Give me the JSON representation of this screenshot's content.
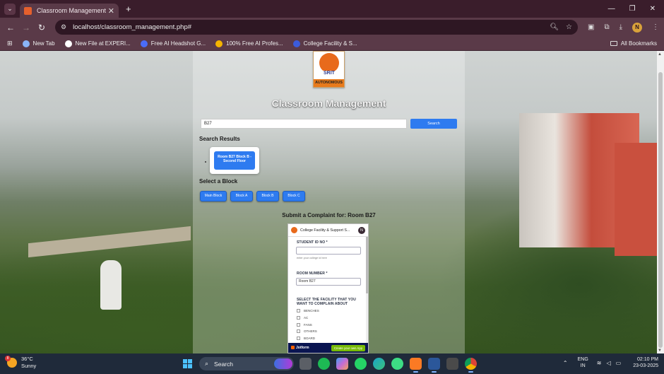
{
  "browser": {
    "tab_title": "Classroom Management",
    "url": "localhost/classroom_management.php#",
    "profile_initial": "N",
    "bookmarks": [
      {
        "label": "New Tab",
        "color": "#8ab4f8"
      },
      {
        "label": "New File at EXPERI...",
        "color": "#ffffff"
      },
      {
        "label": "Free AI Headshot G...",
        "color": "#4a6cf7"
      },
      {
        "label": "100% Free AI Profes...",
        "color": "#f5b400"
      },
      {
        "label": "College Facility & S...",
        "color": "#3b5bdb"
      }
    ],
    "all_bookmarks": "All Bookmarks"
  },
  "page": {
    "logo_text": "SRIT",
    "logo_band": "AUTONOMOUS",
    "title": "Classroom Management",
    "search": {
      "value": "B27",
      "button": "Search"
    },
    "results_heading": "Search Results",
    "result_button": "Room B27 Block B - Second Floor",
    "block_heading": "Select a Block",
    "blocks": [
      "Main Block",
      "Block A",
      "Block B",
      "Block C"
    ],
    "complaint_heading": "Submit a Complaint for: Room B27"
  },
  "form": {
    "header_title": "College Facility & Support S...",
    "avatar": "N",
    "student_label": "STUDENT ID NO *",
    "student_value": "",
    "student_hint": "enter your college id here",
    "room_label": "ROOM NUMBER *",
    "room_value": "Room B27",
    "facility_label_1": "SELECT THE FACILITY THAT YOU",
    "facility_label_2": "WANT TO COMPLAIN ABOUT",
    "options": [
      "BENCHES",
      "AC",
      "FANS",
      "OTHERS",
      "BOARD"
    ],
    "footer_brand": "Jotform",
    "footer_cta": "Create your own App"
  },
  "taskbar": {
    "temp": "36°C",
    "condition": "Sunny",
    "weather_badge": "8",
    "search_placeholder": "Search",
    "lang_1": "ENG",
    "lang_2": "IN",
    "time": "02:10 PM",
    "date": "23-03-2025",
    "apps": [
      {
        "name": "file-explorer-icon",
        "color": "#5b5f66"
      },
      {
        "name": "spotify-icon",
        "color": "#1db954"
      },
      {
        "name": "copilot-icon",
        "color": "#c36bd6"
      },
      {
        "name": "whatsapp-icon",
        "color": "#25d366"
      },
      {
        "name": "edge-icon",
        "color": "#1aa4c8"
      },
      {
        "name": "android-studio-icon",
        "color": "#3ddc84"
      },
      {
        "name": "xampp-icon",
        "color": "#fb7a24"
      },
      {
        "name": "word-icon",
        "color": "#2b579a"
      },
      {
        "name": "sublime-icon",
        "color": "#4a4a4a"
      },
      {
        "name": "chrome-icon",
        "color": "#db4437"
      }
    ]
  }
}
